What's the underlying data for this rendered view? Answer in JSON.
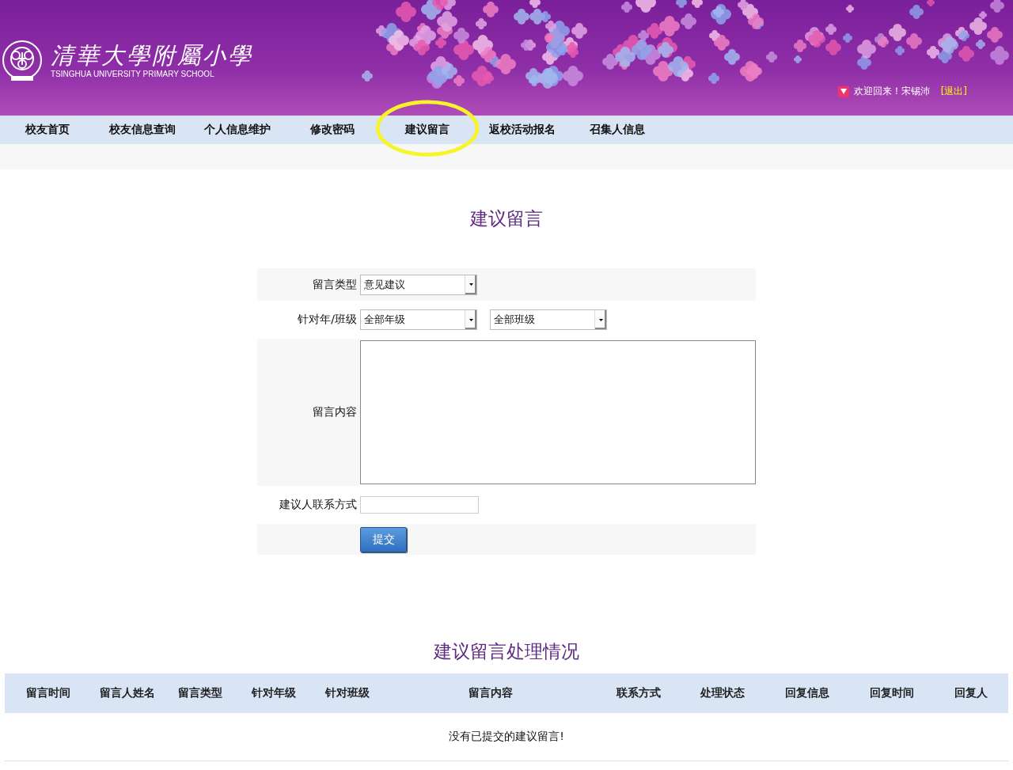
{
  "header": {
    "school_name": "清華大學附屬小學",
    "school_name_en": "TSINGHUA UNIVERSITY PRIMARY SCHOOL",
    "welcome": "欢迎回来！宋锡沛",
    "logout": "[退出]"
  },
  "nav": [
    {
      "label": "校友首页",
      "circled": false
    },
    {
      "label": "校友信息查询",
      "circled": false
    },
    {
      "label": "个人信息维护",
      "circled": false
    },
    {
      "label": "修改密码",
      "circled": false
    },
    {
      "label": "建议留言",
      "circled": true
    },
    {
      "label": "返校活动报名",
      "circled": false
    },
    {
      "label": "召集人信息",
      "circled": false
    }
  ],
  "form": {
    "title": "建议留言",
    "type_label": "留言类型",
    "type_value": "意见建议",
    "target_label": "针对年/班级",
    "grade_value": "全部年级",
    "class_value": "全部班级",
    "content_label": "留言内容",
    "contact_label": "建议人联系方式",
    "submit": "提交"
  },
  "results": {
    "title": "建议留言处理情况",
    "columns": [
      "留言时间",
      "留言人姓名",
      "留言类型",
      "针对年级",
      "针对班级",
      "留言内容",
      "联系方式",
      "处理状态",
      "回复信息",
      "回复时间",
      "回复人"
    ],
    "empty_message": "没有已提交的建议留言!"
  }
}
